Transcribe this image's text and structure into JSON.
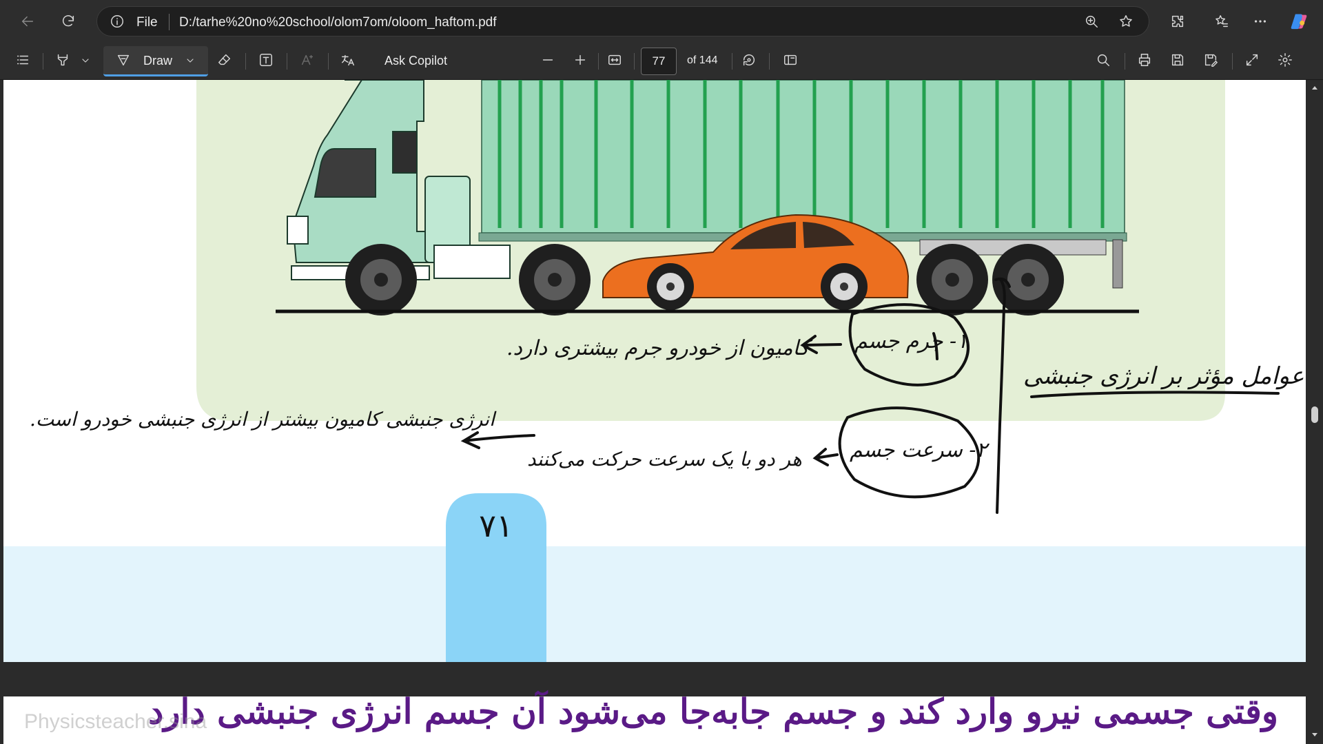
{
  "browser": {
    "address_label": "File",
    "url": "D:/tarhe%20no%20school/olom7om/oloom_haftom.pdf"
  },
  "toolbar": {
    "draw_label": "Draw",
    "ask_copilot_label": "Ask Copilot",
    "page_current": "77",
    "page_total": "of 144"
  },
  "document": {
    "page_number": "۷۱",
    "notes": {
      "title": "عوامل مؤثر بر انرژی جنبشی",
      "factor1": "۱- جرم جسم",
      "factor1_note": "کامیون از خودرو جرم بیشتری دارد.",
      "factor2": "۲- سرعت جسم",
      "factor2_note": "هر دو با یک سرعت حرکت می‌کنند",
      "kinetic_note": "انرژی جنبشی کامیون بیشتر از انرژی جنبشی خودرو است.",
      "bottom_line": "وقتی جسمی نیرو وارد کند و جسم جابه‌جا می‌شود آن جسم انرژی جنبشی دارد"
    },
    "watermark": "Physicsteacher.sina"
  },
  "colors": {
    "green_panel": "#e4efd6",
    "blue_band": "#e3f4fc",
    "tab_blue": "#8bd4f7",
    "truck_cab": "#a9dcc4",
    "container_green": "#9ad8b9",
    "container_stripe": "#23a04f",
    "car_orange": "#ec6f1f",
    "ink_purple": "#5a1a86"
  }
}
